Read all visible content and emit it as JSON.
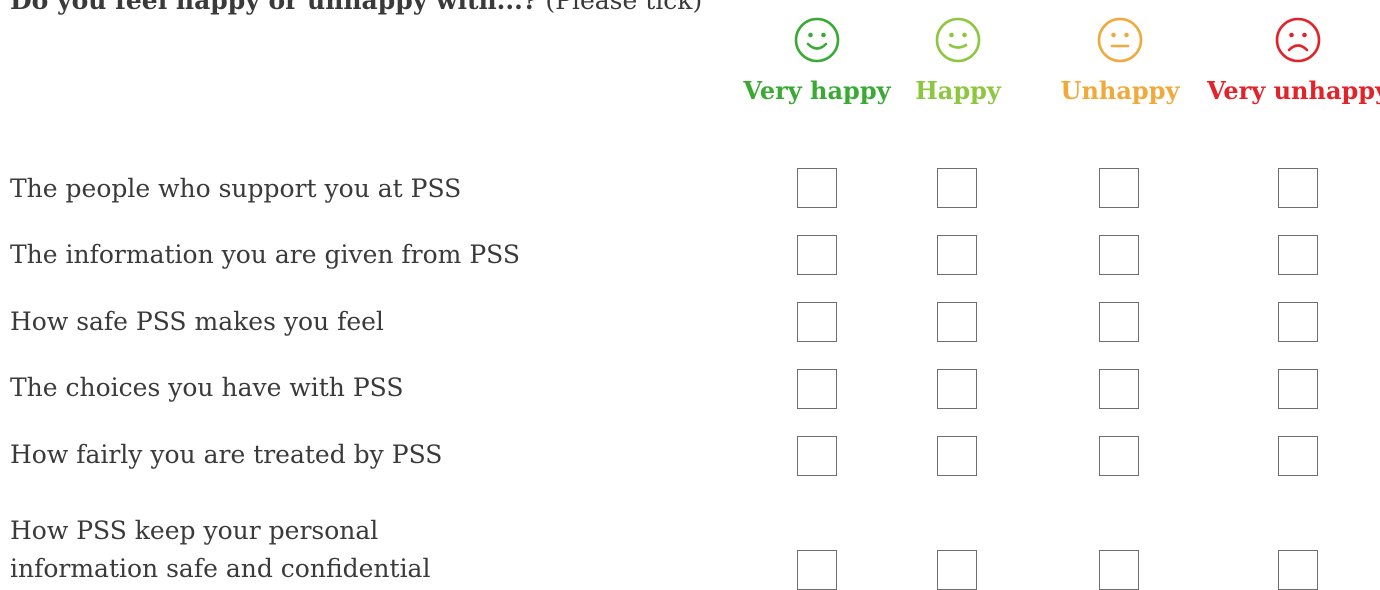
{
  "question": {
    "bold": "Do you feel happy or unhappy with...?",
    "note": "(Please tick)"
  },
  "columns": [
    {
      "label": "Very happy",
      "icon": "very-happy-face-icon",
      "color": "#3aaa35"
    },
    {
      "label": "Happy",
      "icon": "happy-face-icon",
      "color": "#8dc63f"
    },
    {
      "label": "Unhappy",
      "icon": "neutral-face-icon",
      "color": "#f0a93b"
    },
    {
      "label": "Very unhappy",
      "icon": "sad-face-icon",
      "color": "#e2232a"
    }
  ],
  "rows": [
    "The people who support you at PSS",
    "The information you are given from PSS",
    "How safe PSS makes you feel",
    "The choices you have with PSS",
    "How fairly you are treated by PSS",
    "How PSS keep your personal information safe and confidential"
  ]
}
